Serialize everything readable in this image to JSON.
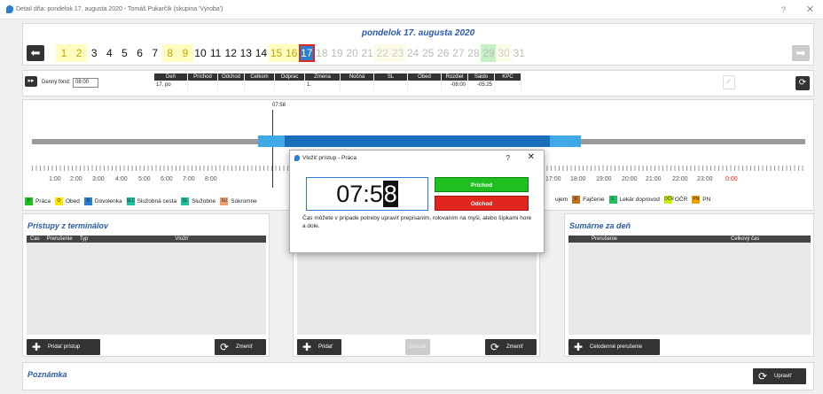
{
  "window": {
    "title": "Detail dňa: pondelok 17. augusta 2020 - Tomáš Pukarčík (skupina 'Výroba')",
    "help": "?",
    "close": "✕"
  },
  "date_header": {
    "title": "pondelok 17. augusta 2020",
    "prev": "⬅",
    "next": "➡",
    "days": [
      {
        "n": "1",
        "s": "y"
      },
      {
        "n": "2",
        "s": "y"
      },
      {
        "n": "3",
        "s": "n"
      },
      {
        "n": "4",
        "s": "n"
      },
      {
        "n": "5",
        "s": "n"
      },
      {
        "n": "6",
        "s": "n"
      },
      {
        "n": "7",
        "s": "n"
      },
      {
        "n": "8",
        "s": "y"
      },
      {
        "n": "9",
        "s": "y"
      },
      {
        "n": "10",
        "s": "n"
      },
      {
        "n": "11",
        "s": "n"
      },
      {
        "n": "12",
        "s": "n"
      },
      {
        "n": "13",
        "s": "n"
      },
      {
        "n": "14",
        "s": "n"
      },
      {
        "n": "15",
        "s": "y"
      },
      {
        "n": "16",
        "s": "y"
      },
      {
        "n": "17",
        "s": "cur"
      },
      {
        "n": "18",
        "s": "f"
      },
      {
        "n": "19",
        "s": "f"
      },
      {
        "n": "20",
        "s": "f"
      },
      {
        "n": "21",
        "s": "f"
      },
      {
        "n": "22",
        "s": "fy"
      },
      {
        "n": "23",
        "s": "fy"
      },
      {
        "n": "24",
        "s": "f"
      },
      {
        "n": "25",
        "s": "f"
      },
      {
        "n": "26",
        "s": "f"
      },
      {
        "n": "27",
        "s": "f"
      },
      {
        "n": "28",
        "s": "f"
      },
      {
        "n": "29",
        "s": "fg"
      },
      {
        "n": "30",
        "s": "fy"
      },
      {
        "n": "31",
        "s": "f"
      }
    ]
  },
  "toolbar": {
    "denny_fond_label": "Denný fond:",
    "denny_fond_value": "08:00",
    "columns": [
      {
        "h": "Deň",
        "v": "17. po",
        "w": 38
      },
      {
        "h": "Príchod",
        "v": "",
        "w": 34
      },
      {
        "h": "Odchod",
        "v": "",
        "w": 30
      },
      {
        "h": "Celkom",
        "v": "",
        "w": 34
      },
      {
        "h": "Odprac",
        "v": "",
        "w": 34
      },
      {
        "h": "Zmena",
        "v": "1.",
        "w": 40
      },
      {
        "h": "Nočná",
        "v": "",
        "w": 38
      },
      {
        "h": "SL",
        "v": "",
        "w": 38
      },
      {
        "h": "Obed",
        "v": "",
        "w": 38
      },
      {
        "h": "Rozdiel",
        "v": "-08:00",
        "w": 30
      },
      {
        "h": "Saldo",
        "v": "-05:25",
        "w": 30
      },
      {
        "h": "KPČ",
        "v": "",
        "w": 30
      }
    ],
    "check": "✓",
    "refresh": "⟳"
  },
  "timeline": {
    "marker": "07:58",
    "hours": [
      "1:00",
      "2:00",
      "3:00",
      "4:00",
      "5:00",
      "6:00",
      "7:00",
      "8:00",
      "17:00",
      "18:00",
      "19:00",
      "20:00",
      "21:00",
      "22:00",
      "23:00",
      "0:00"
    ],
    "legend": [
      {
        "code": "P",
        "label": "Práca",
        "color": "#1fbf1f"
      },
      {
        "code": "O",
        "label": "Obed",
        "color": "#ffe600"
      },
      {
        "code": "D",
        "label": "Dovolenka",
        "color": "#2a7fd4"
      },
      {
        "code": "SLC",
        "label": "Služobná cesta",
        "color": "#1fbf9f"
      },
      {
        "code": "SL",
        "label": "Služobne",
        "color": "#1fbf9f"
      },
      {
        "code": "SU",
        "label": "Súkromne",
        "color": "#f0a070"
      }
    ],
    "legend2": [
      {
        "code": "",
        "label": "ujem",
        "color": ""
      },
      {
        "code": "F",
        "label": "Fajčenie",
        "color": "#c07020"
      },
      {
        "code": "L",
        "label": "Lekár doprovod",
        "color": "#20c060"
      },
      {
        "code": "OČR",
        "label": "OČR",
        "color": "#c8f000"
      },
      {
        "code": "PN",
        "label": "PN",
        "color": "#f0a000"
      }
    ]
  },
  "left_section": {
    "title": "Prístupy z terminálov",
    "cols": [
      "Čas",
      "Prerušenie",
      "Typ",
      "Vložiť"
    ],
    "add": "Pridať prístup",
    "change": "Zmeniť"
  },
  "mid_section": {
    "add": "Pridať",
    "delete": "Zmazať",
    "change": "Zmeniť"
  },
  "right_section": {
    "title": "Sumárne za deň",
    "cols": [
      "Prerušenie",
      "Celkový čas"
    ],
    "add": "Celodenné prerušenie"
  },
  "note": {
    "title": "Poznámka",
    "edit": "Upraviť"
  },
  "modal": {
    "title": "Vložiť prístup - Práca",
    "help": "?",
    "close": "✕",
    "time_a": "07:5",
    "time_b": "8",
    "arrival": "Príchod",
    "departure": "Odchod",
    "hint": "Čas môžete v prípade potreby upraviť prepísaním, rolovaním na myši, alebo šípkami hore a dole."
  }
}
